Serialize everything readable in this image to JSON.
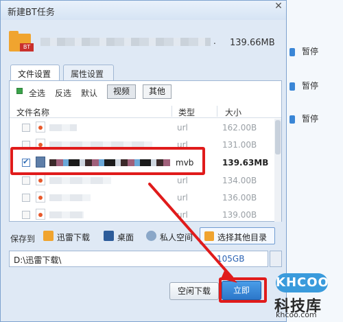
{
  "background": {
    "pause_labels": [
      "暂停",
      "暂停",
      "暂停"
    ]
  },
  "dialog": {
    "title": "新建BT任务",
    "close_glyph": "✕",
    "file": {
      "icon_tag": "BT",
      "ext_hint": ".",
      "size": "139.66MB"
    },
    "tabs": [
      "文件设置",
      "属性设置"
    ],
    "filter": {
      "all": "全选",
      "invert": "反选",
      "default": "默认",
      "video": "视频",
      "other": "其他"
    },
    "columns": {
      "name": "文件名称",
      "type": "类型",
      "size": "大小"
    },
    "rows": [
      {
        "type": "url",
        "size": "162.00B",
        "checked": false,
        "selected": false
      },
      {
        "type": "url",
        "size": "131.00B",
        "checked": false,
        "selected": false
      },
      {
        "type": "mvb",
        "size": "139.63MB",
        "checked": true,
        "selected": true
      },
      {
        "type": "url",
        "size": "134.00B",
        "checked": false,
        "selected": false
      },
      {
        "type": "url",
        "size": "136.00B",
        "checked": false,
        "selected": false
      },
      {
        "type": "url",
        "size": "139.00B",
        "checked": false,
        "selected": false
      }
    ],
    "save_to": {
      "label": "保存到",
      "xunlei": "迅雷下载",
      "desktop": "桌面",
      "private": "私人空间",
      "choose_other": "选择其他目录"
    },
    "path": {
      "value": "D:\\迅雷下载\\",
      "free": "105GB"
    },
    "buttons": {
      "idle_download": "空闲下载",
      "download_now": "立即"
    }
  },
  "watermark": {
    "badge": "KHCOO",
    "name": "科技库",
    "url": "khcoo.com"
  },
  "colors": {
    "highlight": "#e01b1b",
    "primary_button": "#2c77c9",
    "folder": "#f0a42f"
  }
}
